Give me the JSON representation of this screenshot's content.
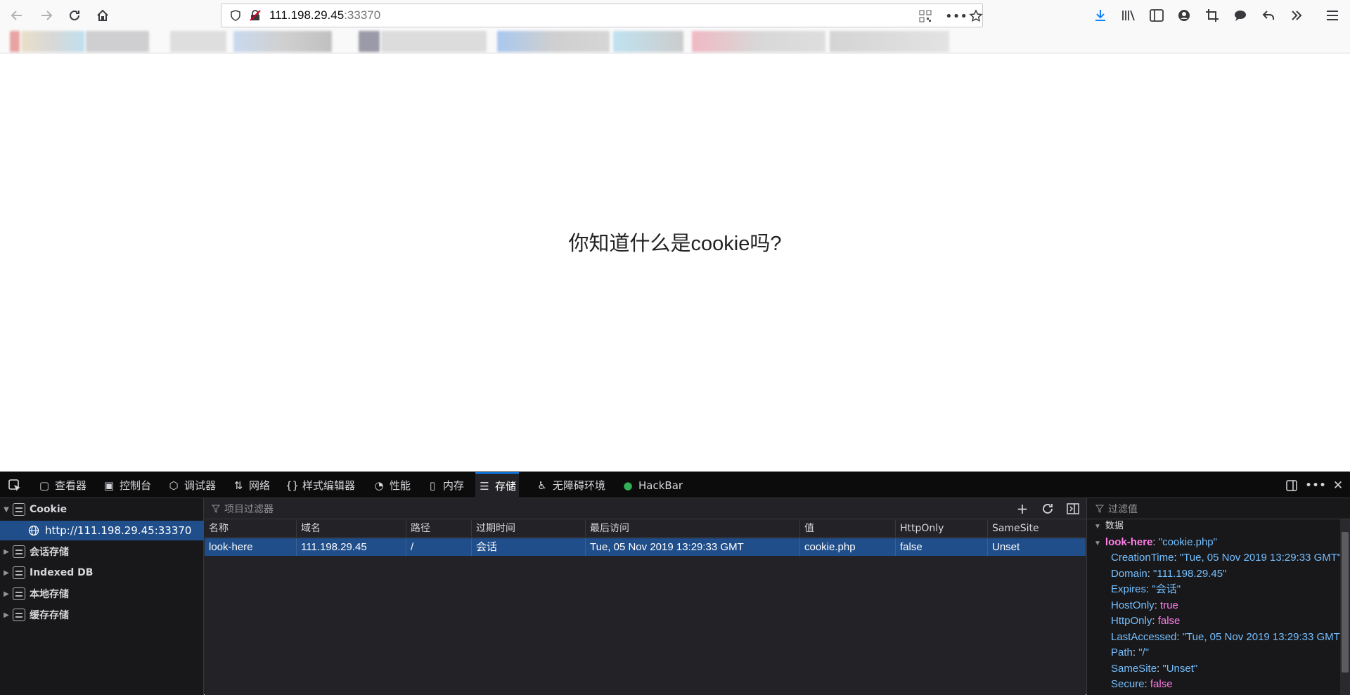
{
  "browser": {
    "url_host": "111.198.29.45",
    "url_port": ":33370",
    "icons": {
      "back": "back-arrow-icon",
      "forward": "forward-arrow-icon",
      "reload": "reload-icon",
      "home": "home-icon",
      "shield": "tracking-protection-shield-icon",
      "insecure": "insecure-lock-icon",
      "qr": "qr-code-icon",
      "more": "more-actions-icon",
      "bookmark": "bookmark-star-icon",
      "download": "download-icon",
      "library": "library-icon",
      "sidebar": "sidebar-icon",
      "account": "account-icon",
      "screenshot": "crop-icon",
      "comment": "speech-bubble-icon",
      "undo": "undo-icon",
      "overflow": "overflow-chevrons-icon",
      "menu": "hamburger-menu-icon"
    }
  },
  "page": {
    "heading": "你知道什么是cookie吗?"
  },
  "devtools": {
    "tabs": [
      {
        "label": "查看器",
        "icon": "inspector-icon"
      },
      {
        "label": "控制台",
        "icon": "console-icon"
      },
      {
        "label": "调试器",
        "icon": "debugger-icon"
      },
      {
        "label": "网络",
        "icon": "network-icon"
      },
      {
        "label": "样式编辑器",
        "icon": "style-editor-icon"
      },
      {
        "label": "性能",
        "icon": "performance-icon"
      },
      {
        "label": "内存",
        "icon": "memory-icon"
      },
      {
        "label": "存储",
        "icon": "storage-icon"
      },
      {
        "label": "无障碍环境",
        "icon": "accessibility-icon"
      },
      {
        "label": "HackBar",
        "icon": "hackbar-icon"
      }
    ],
    "active_tab": "存储",
    "accent_color": "#0a84ff",
    "sidebar": {
      "items": [
        {
          "label": "Cookie"
        },
        {
          "label": "http://111.198.29.45:33370"
        },
        {
          "label": "会话存储"
        },
        {
          "label": "Indexed DB"
        },
        {
          "label": "本地存储"
        },
        {
          "label": "缓存存储"
        }
      ]
    },
    "table": {
      "filter_placeholder": "项目过滤器",
      "columns": [
        "名称",
        "域名",
        "路径",
        "过期时间",
        "最后访问",
        "值",
        "HttpOnly",
        "SameSite"
      ],
      "rows": [
        [
          "look-here",
          "111.198.29.45",
          "/",
          "会话",
          "Tue, 05 Nov 2019 13:29:33 GMT",
          "cookie.php",
          "false",
          "Unset"
        ]
      ]
    },
    "details": {
      "filter_placeholder": "过滤值",
      "section": "数据",
      "cookie_name": "look-here",
      "cookie_value": "\"cookie.php\"",
      "fields": [
        {
          "key": "CreationTime",
          "value": "\"Tue, 05 Nov 2019 13:29:33 GMT\"",
          "kind": "str"
        },
        {
          "key": "Domain",
          "value": "\"111.198.29.45\"",
          "kind": "str"
        },
        {
          "key": "Expires",
          "value": "\"会话\"",
          "kind": "str"
        },
        {
          "key": "HostOnly",
          "value": "true",
          "kind": "bool"
        },
        {
          "key": "HttpOnly",
          "value": "false",
          "kind": "bool"
        },
        {
          "key": "LastAccessed",
          "value": "\"Tue, 05 Nov 2019 13:29:33 GMT\"",
          "kind": "str"
        },
        {
          "key": "Path",
          "value": "\"/\"",
          "kind": "str"
        },
        {
          "key": "SameSite",
          "value": "\"Unset\"",
          "kind": "str"
        },
        {
          "key": "Secure",
          "value": "false",
          "kind": "bool"
        }
      ]
    }
  }
}
